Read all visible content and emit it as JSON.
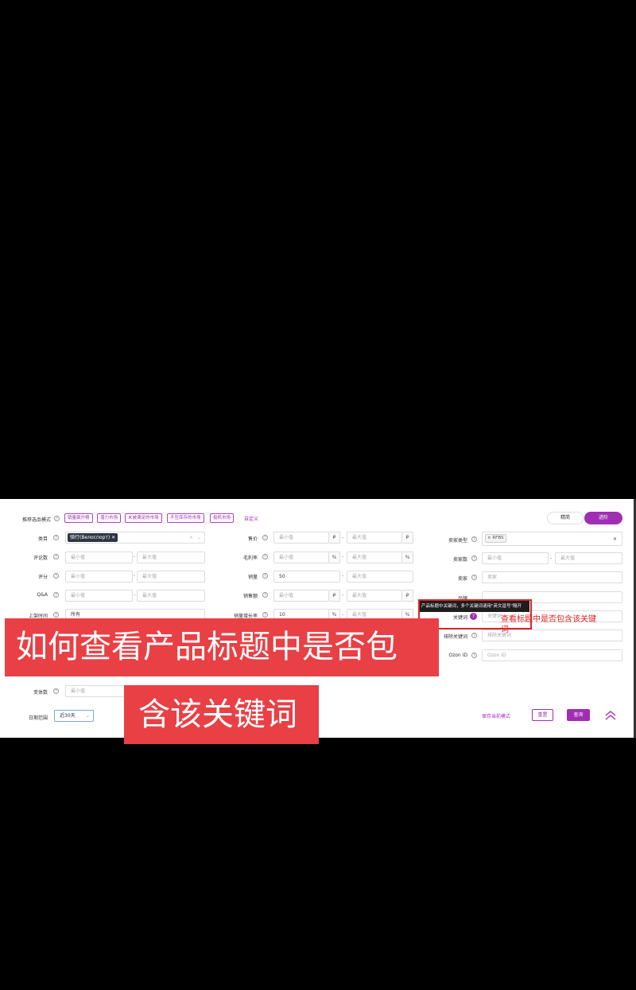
{
  "filters": {
    "recommend_mode_label": "推荐选品模式",
    "chips": [
      "销量飙升榜",
      "潜力市场",
      "未被满足的市场",
      "不压库存的市场",
      "投机市场"
    ],
    "custom_label": "自定义",
    "simple_btn": "精简",
    "advanced_btn": "进阶",
    "category_label": "类目",
    "category_tag": "骑行(Велоспорт)",
    "reviews_label": "评论数",
    "rating_label": "评分",
    "qa_label": "Q&A",
    "listing_time_label": "上架时间",
    "listing_time_value": "所有",
    "variants_label": "变体数",
    "date_range_label": "日期范围",
    "date_range_value": "近30天",
    "price_label": "售价",
    "margin_label": "毛利率",
    "sales_label": "销量",
    "sales_min": "50",
    "sales_amount_label": "销售额",
    "growth_label": "销量增长率",
    "growth_min": "10",
    "seller_type_label": "卖家类型",
    "seller_type_tag": "RFBS",
    "seller_count_label": "卖家数",
    "seller_label": "卖家",
    "seller_placeholder": "卖家",
    "brand_label": "品牌",
    "keyword_label": "关键词",
    "keyword_placeholder": "关键词",
    "exclude_keyword_label": "排除关键词",
    "exclude_keyword_placeholder": "排除关键词",
    "ozon_id_label": "Ozon ID",
    "ozon_id_placeholder": "Ozon ID",
    "min_placeholder": "最小值",
    "max_placeholder": "最大值",
    "currency": "₽",
    "percent": "%",
    "dash": "-",
    "save_mode": "保存当前模式",
    "reset_btn": "重置",
    "search_btn": "查询"
  },
  "tooltip": {
    "text": "产品标题中关键词，多个关键词请用\"英文逗号\"隔开",
    "annotation": "查看标题中是否包含该关键词"
  },
  "overlay": {
    "line1": "如何查看产品标题中是否包",
    "line2": "含该关键词"
  },
  "colors": {
    "accent": "#a02eb3",
    "overlay_red": "#e84045",
    "annotation_red": "#e02020"
  }
}
